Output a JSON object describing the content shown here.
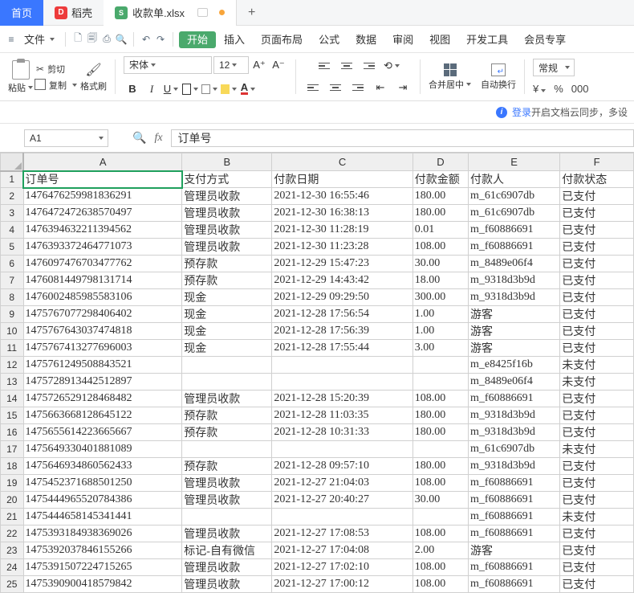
{
  "tabs": {
    "home": "首页",
    "docer": "稻壳",
    "file": "收款单.xlsx",
    "add": "+"
  },
  "menu": {
    "file": "文件",
    "tabs": [
      "开始",
      "插入",
      "页面布局",
      "公式",
      "数据",
      "审阅",
      "视图",
      "开发工具",
      "会员专享"
    ],
    "active_idx": 0
  },
  "ribbon": {
    "paste": "粘贴",
    "cut": "剪切",
    "copy": "复制",
    "format_painter": "格式刷",
    "font_name": "宋体",
    "font_size": "12",
    "merge_center": "合并居中",
    "wrap": "自动换行",
    "num_format": "常规",
    "currency": "¥",
    "percent": "%",
    "thousands": "000"
  },
  "sync": {
    "text": "登录开启文档云同步，多设"
  },
  "name_box": "A1",
  "fx_value": "订单号",
  "cols": [
    "A",
    "B",
    "C",
    "D",
    "E",
    "F"
  ],
  "headers": [
    "订单号",
    "支付方式",
    "付款日期",
    "付款金额",
    "付款人",
    "付款状态"
  ],
  "rows": [
    [
      "1476476259981836291",
      "管理员收款",
      "2021-12-30 16:55:46",
      "180.00",
      "m_61c6907db",
      "已支付"
    ],
    [
      "1476472472638570497",
      "管理员收款",
      "2021-12-30 16:38:13",
      "180.00",
      "m_61c6907db",
      "已支付"
    ],
    [
      "1476394632211394562",
      "管理员收款",
      "2021-12-30 11:28:19",
      "0.01",
      "m_f60886691",
      "已支付"
    ],
    [
      "1476393372464771073",
      "管理员收款",
      "2021-12-30 11:23:28",
      "108.00",
      "m_f60886691",
      "已支付"
    ],
    [
      "1476097476703477762",
      "预存款",
      "2021-12-29 15:47:23",
      "30.00",
      "m_8489e06f4",
      "已支付"
    ],
    [
      "1476081449798131714",
      "预存款",
      "2021-12-29 14:43:42",
      "18.00",
      "m_9318d3b9d",
      "已支付"
    ],
    [
      "1476002485985583106",
      "现金",
      "2021-12-29 09:29:50",
      "300.00",
      "m_9318d3b9d",
      "已支付"
    ],
    [
      "1475767077298406402",
      "现金",
      "2021-12-28 17:56:54",
      "1.00",
      "游客",
      "已支付"
    ],
    [
      "1475767643037474818",
      "现金",
      "2021-12-28 17:56:39",
      "1.00",
      "游客",
      "已支付"
    ],
    [
      "1475767413277696003",
      "现金",
      "2021-12-28 17:55:44",
      "3.00",
      "游客",
      "已支付"
    ],
    [
      "1475761249508843521",
      "",
      "",
      "",
      "m_e8425f16b",
      "未支付"
    ],
    [
      "1475728913442512897",
      "",
      "",
      "",
      "m_8489e06f4",
      "未支付"
    ],
    [
      "1475726529128468482",
      "管理员收款",
      "2021-12-28 15:20:39",
      "108.00",
      "m_f60886691",
      "已支付"
    ],
    [
      "1475663668128645122",
      "预存款",
      "2021-12-28 11:03:35",
      "180.00",
      "m_9318d3b9d",
      "已支付"
    ],
    [
      "1475655614223665667",
      "预存款",
      "2021-12-28 10:31:33",
      "180.00",
      "m_9318d3b9d",
      "已支付"
    ],
    [
      "1475649330401881089",
      "",
      "",
      "",
      "m_61c6907db",
      "未支付"
    ],
    [
      "1475646934860562433",
      "预存款",
      "2021-12-28 09:57:10",
      "180.00",
      "m_9318d3b9d",
      "已支付"
    ],
    [
      "1475452371688501250",
      "管理员收款",
      "2021-12-27 21:04:03",
      "108.00",
      "m_f60886691",
      "已支付"
    ],
    [
      "1475444965520784386",
      "管理员收款",
      "2021-12-27 20:40:27",
      "30.00",
      "m_f60886691",
      "已支付"
    ],
    [
      "1475444658145341441",
      "",
      "",
      "",
      "m_f60886691",
      "未支付"
    ],
    [
      "1475393184938369026",
      "管理员收款",
      "2021-12-27 17:08:53",
      "108.00",
      "m_f60886691",
      "已支付"
    ],
    [
      "1475392037846155266",
      "标记-自有微信",
      "2021-12-27 17:04:08",
      "2.00",
      "游客",
      "已支付"
    ],
    [
      "1475391507224715265",
      "管理员收款",
      "2021-12-27 17:02:10",
      "108.00",
      "m_f60886691",
      "已支付"
    ],
    [
      "1475390900418579842",
      "管理员收款",
      "2021-12-27 17:00:12",
      "108.00",
      "m_f60886691",
      "已支付"
    ]
  ]
}
